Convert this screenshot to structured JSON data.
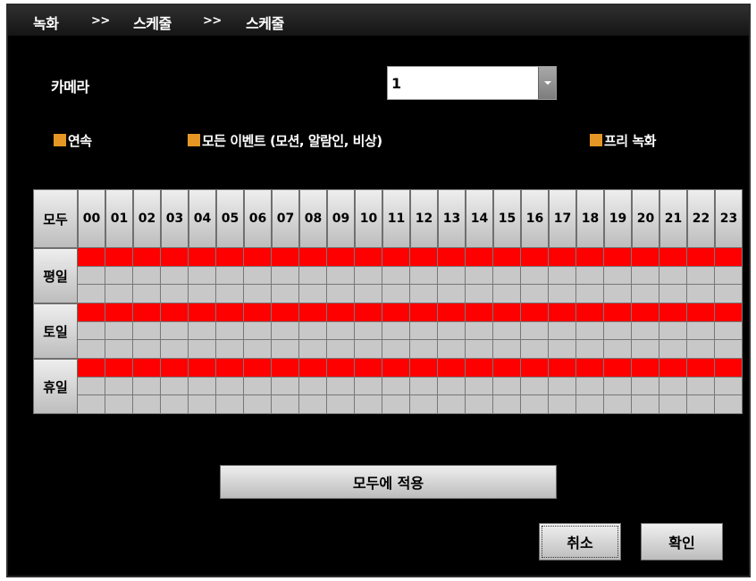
{
  "breadcrumb": {
    "items": [
      "녹화",
      "스케줄",
      "스케줄"
    ],
    "separator": ">>"
  },
  "camera": {
    "label": "카메라",
    "selected": "1"
  },
  "legend": {
    "continuous": "연속",
    "all_events": "모든 이벤트 (모션, 알람인, 비상)",
    "pre_record": "프리 녹화",
    "swatch_color": "#e69624"
  },
  "schedule": {
    "all_label": "모두",
    "hours": [
      "00",
      "01",
      "02",
      "03",
      "04",
      "05",
      "06",
      "07",
      "08",
      "09",
      "10",
      "11",
      "12",
      "13",
      "14",
      "15",
      "16",
      "17",
      "18",
      "19",
      "20",
      "21",
      "22",
      "23"
    ],
    "days": [
      {
        "label": "평일",
        "rows": [
          "on",
          "off",
          "off"
        ]
      },
      {
        "label": "토일",
        "rows": [
          "on",
          "off",
          "off"
        ]
      },
      {
        "label": "휴일",
        "rows": [
          "on",
          "off",
          "off"
        ]
      }
    ],
    "colors": {
      "on": "#ff0000",
      "off": "#c8c8c8"
    }
  },
  "actions": {
    "apply_all": "모두에 적용",
    "cancel": "취소",
    "ok": "확인"
  }
}
